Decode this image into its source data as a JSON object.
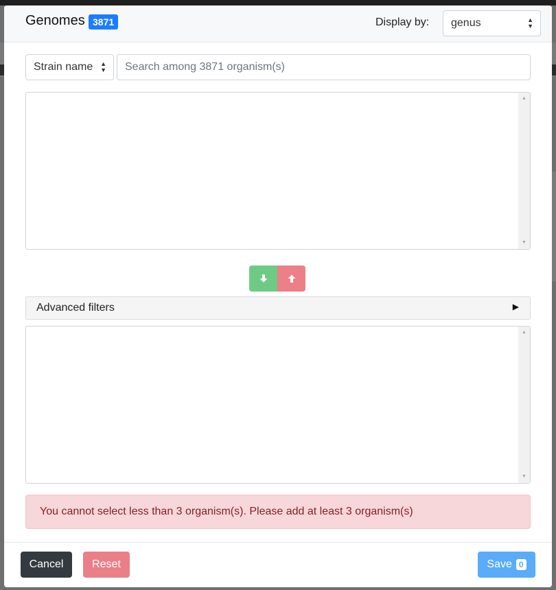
{
  "header": {
    "title": "Genomes",
    "count_badge": "3871",
    "display_by_label": "Display by:",
    "display_by_value": "genus"
  },
  "search": {
    "field_select_value": "Strain name",
    "placeholder": "Search among 3871 organism(s)",
    "value": ""
  },
  "available_list": {
    "items": []
  },
  "transfer": {
    "add_icon": "arrow-down-icon",
    "remove_icon": "arrow-up-icon"
  },
  "advanced_filters": {
    "label": "Advanced filters",
    "expanded": false
  },
  "selected_list": {
    "items": []
  },
  "alert": {
    "message": "You cannot select less than 3 organism(s). Please add at least 3 organism(s)"
  },
  "footer": {
    "cancel_label": "Cancel",
    "reset_label": "Reset",
    "save_label": "Save",
    "save_count": "0"
  },
  "colors": {
    "badge": "#1b7cff",
    "add_button": "#6fca86",
    "remove_button": "#ec7f87",
    "alert_bg": "#f8d7da",
    "alert_text": "#842029",
    "cancel_button": "#343a40",
    "reset_button": "#ea7f88",
    "save_button": "#5aabf9"
  }
}
